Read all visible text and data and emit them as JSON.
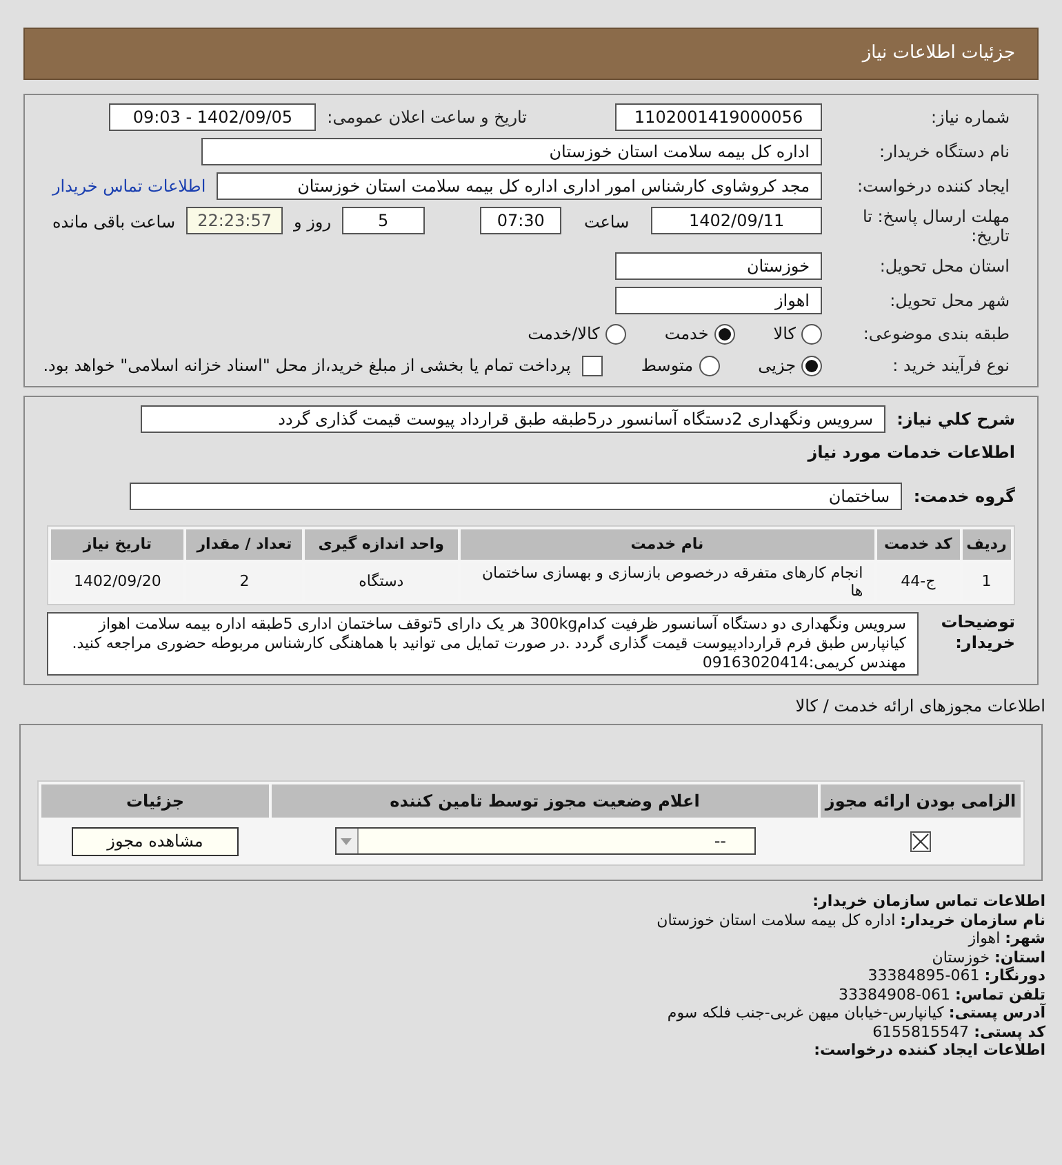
{
  "header": {
    "title": "جزئیات اطلاعات نیاز"
  },
  "need": {
    "number": {
      "label": "شماره نیاز:",
      "value": "1102001419000056"
    },
    "announce": {
      "label": "تاریخ و ساعت اعلان عمومی:",
      "value": "1402/09/05 - 09:03"
    },
    "buyer": {
      "label": "نام دستگاه خریدار:",
      "value": "اداره کل بیمه سلامت استان خوزستان"
    },
    "creator": {
      "label": "ایجاد کننده درخواست:",
      "value": "مجد کروشاوی کارشناس امور اداری اداره کل بیمه سلامت استان خوزستان",
      "link": "اطلاعات تماس خریدار"
    },
    "deadline": {
      "label": "مهلت ارسال پاسخ: تا تاریخ:",
      "date": "1402/09/11",
      "time_label": "ساعت",
      "time": "07:30",
      "days": "5",
      "days_label": "روز و",
      "remaining": "22:23:57",
      "remaining_label": "ساعت باقی مانده"
    },
    "province": {
      "label": "استان محل تحویل:",
      "value": "خوزستان"
    },
    "city": {
      "label": "شهر محل تحویل:",
      "value": "اهواز"
    },
    "category": {
      "label": "طبقه بندی موضوعی:",
      "options": [
        {
          "label": "کالا",
          "selected": false
        },
        {
          "label": "خدمت",
          "selected": true
        },
        {
          "label": "کالا/خدمت",
          "selected": false
        }
      ]
    },
    "process": {
      "label": "نوع فرآیند خرید :",
      "options": [
        {
          "label": "جزیی",
          "selected": true
        },
        {
          "label": "متوسط",
          "selected": false
        }
      ],
      "treasury": {
        "label": "پرداخت تمام یا بخشی از مبلغ خرید،از محل \"اسناد خزانه اسلامی\" خواهد بود.",
        "checked": false
      }
    }
  },
  "services": {
    "summary": {
      "label": "شرح کلي نياز:",
      "value": "سرویس ونگهداری 2دستگاه آسانسور در5طبقه طبق قرارداد پیوست قیمت گذاری گردد"
    },
    "title": "اطلاعات خدمات مورد نیاز",
    "group": {
      "label": "گروه خدمت:",
      "value": "ساختمان"
    },
    "table": {
      "columns": [
        "ردیف",
        "کد خدمت",
        "نام خدمت",
        "واحد اندازه گیری",
        "تعداد / مقدار",
        "تاریخ نیاز"
      ],
      "rows": [
        [
          "1",
          "ج-44",
          "انجام کارهای متفرقه درخصوص بازسازی و بهسازی ساختمان ها",
          "دستگاه",
          "2",
          "1402/09/20"
        ]
      ]
    },
    "notes": {
      "label": "توضیحات خریدار:",
      "value": "سرویس ونگهداری دو دستگاه آسانسور ظرفیت کدام300kg هر یک دارای 5توقف ساختمان اداری 5طبقه اداره بیمه سلامت اهواز کیانپارس طبق فرم قراردادپیوست قیمت گذاری گردد .در صورت تمایل می توانید با هماهنگی کارشناس مربوطه حضوری مراجعه کنید. مهندس کریمی:09163020414"
    }
  },
  "permits": {
    "title": "اطلاعات مجوزهای ارائه خدمت / کالا",
    "columns": [
      "الزامی بودن ارائه مجوز",
      "اعلام وضعیت مجوز توسط تامین کننده",
      "جزئیات"
    ],
    "rows": [
      {
        "required": true,
        "status": "--",
        "button": "مشاهده مجوز"
      }
    ]
  },
  "contact": {
    "title": "اطلاعات تماس سازمان خریدار:",
    "lines": [
      {
        "label": "نام سازمان خریدار:",
        "value": "اداره کل بیمه سلامت استان خوزستان"
      },
      {
        "label": "شهر:",
        "value": "اهواز"
      },
      {
        "label": "استان:",
        "value": "خوزستان"
      },
      {
        "label": "دورنگار:",
        "value": "061-33384895"
      },
      {
        "label": "تلفن تماس:",
        "value": "061-33384908"
      },
      {
        "label": "آدرس پستی:",
        "value": "کیانپارس-خیابان میهن غربی-جنب فلکه سوم"
      },
      {
        "label": "کد پستی:",
        "value": "6155815547"
      }
    ],
    "footer": "اطلاعات ایجاد کننده درخواست:"
  }
}
